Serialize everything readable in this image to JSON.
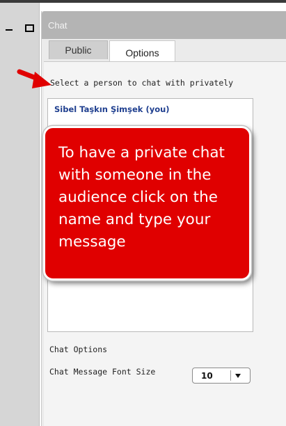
{
  "window_controls": {
    "minimize_icon": "minimize-icon",
    "maximize_icon": "maximize-icon"
  },
  "chat": {
    "title": "Chat",
    "tabs": [
      {
        "label": "Public",
        "selected": false
      },
      {
        "label": "Options",
        "selected": true
      }
    ],
    "options": {
      "select_label": "Select a person to chat with privately",
      "users": [
        {
          "name": "Sibel Taşkın Şimşek (you)"
        }
      ],
      "chat_options_label": "Chat Options",
      "font_size_label": "Chat Message Font Size",
      "font_size_value": "10",
      "font_size_icon": "chevron-down-icon"
    }
  },
  "annotation": {
    "text": "To have a private chat with someone in the audience click on the name and type your message",
    "color": "#e00000",
    "arrow_color": "#e00000"
  }
}
